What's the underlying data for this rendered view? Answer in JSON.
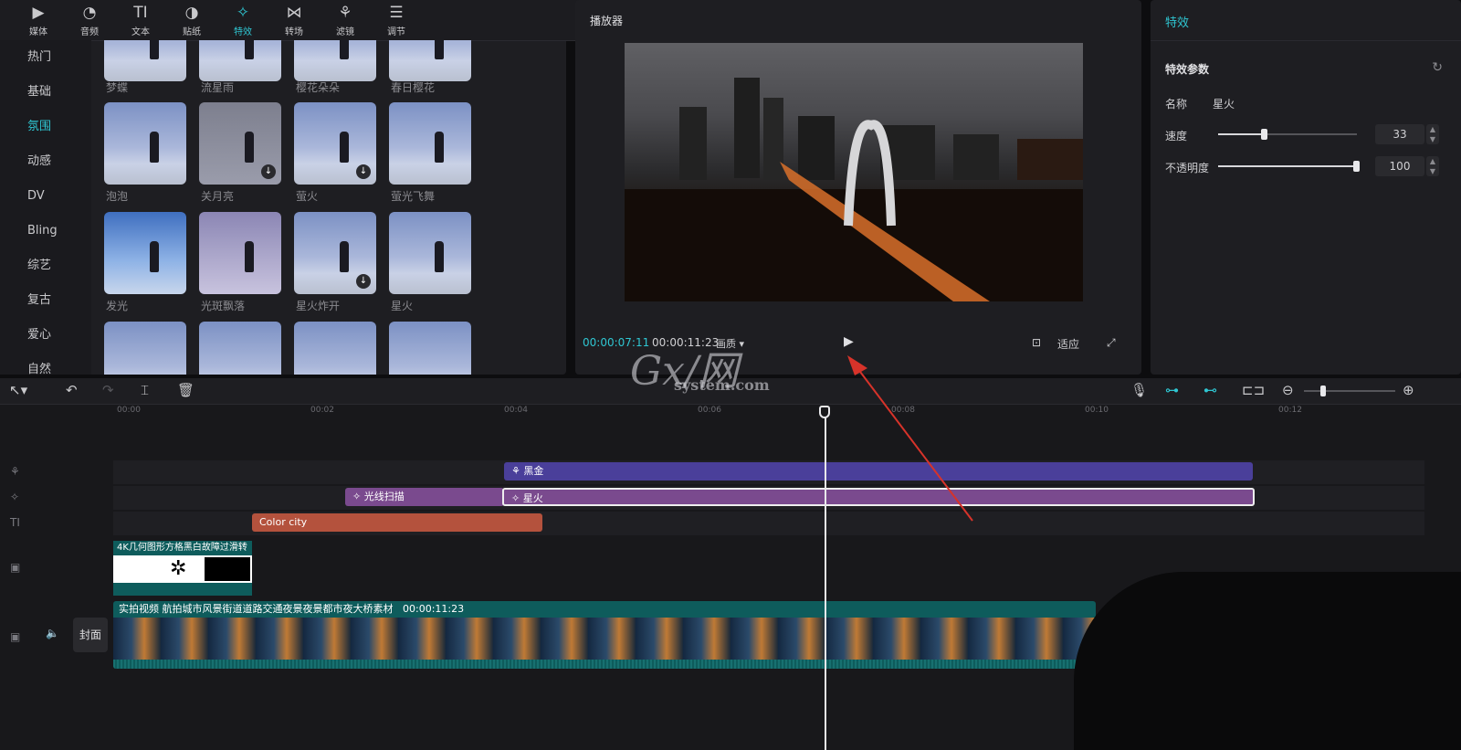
{
  "top_tabs": [
    {
      "label": "媒体",
      "icon": "media-icon"
    },
    {
      "label": "音频",
      "icon": "audio-icon"
    },
    {
      "label": "文本",
      "icon": "text-icon"
    },
    {
      "label": "贴纸",
      "icon": "sticker-icon"
    },
    {
      "label": "特效",
      "icon": "effects-icon",
      "active": true
    },
    {
      "label": "转场",
      "icon": "transition-icon"
    },
    {
      "label": "滤镜",
      "icon": "filter-icon"
    },
    {
      "label": "调节",
      "icon": "adjust-icon"
    }
  ],
  "categories": [
    "热门",
    "基础",
    "氛围",
    "动感",
    "DV",
    "Bling",
    "综艺",
    "复古",
    "爱心",
    "自然"
  ],
  "effects_grid": {
    "row0_labels": [
      "梦蝶",
      "流星雨",
      "樱花朵朵",
      "春日樱花"
    ],
    "row1_labels": [
      "泡泡",
      "关月亮",
      "萤火",
      "萤光飞舞"
    ],
    "row2_labels": [
      "发光",
      "光斑飘落",
      "星火炸开",
      "星火"
    ]
  },
  "player": {
    "title": "播放器",
    "current_time": "00:00:07:11",
    "duration": "00:00:11:23",
    "ratio_label": "画质",
    "fit_label": "适应"
  },
  "effects_panel": {
    "title": "特效",
    "section": "特效参数",
    "name_label": "名称",
    "name_value": "星火",
    "speed_label": "速度",
    "speed_value": "33",
    "opacity_label": "不透明度",
    "opacity_value": "100"
  },
  "timeline": {
    "ruler": [
      "00:00",
      "00:02",
      "00:04",
      "00:06",
      "00:08",
      "00:10",
      "00:12"
    ],
    "filter_clip": "黑金",
    "effect_clip_1": "光线扫描",
    "effect_clip_2": "星火",
    "text_clip": "Color city",
    "overlay_clip_title": "4K几何图形方格黑白故障过滑转",
    "main_clip_title": "实拍视频 航拍城市风景街道道路交通夜景夜景都市夜大桥素材",
    "main_clip_duration": "00:00:11:23",
    "cover_label": "封面"
  },
  "watermark": {
    "big": "Gx/网",
    "small": "system.com"
  },
  "colors": {
    "accent": "#2fc6d2",
    "filter_clip": "#4a3f9a",
    "effect_clip": "#7a4a8e",
    "text_clip": "#b4523d",
    "video_clip": "#0e5c5c"
  }
}
